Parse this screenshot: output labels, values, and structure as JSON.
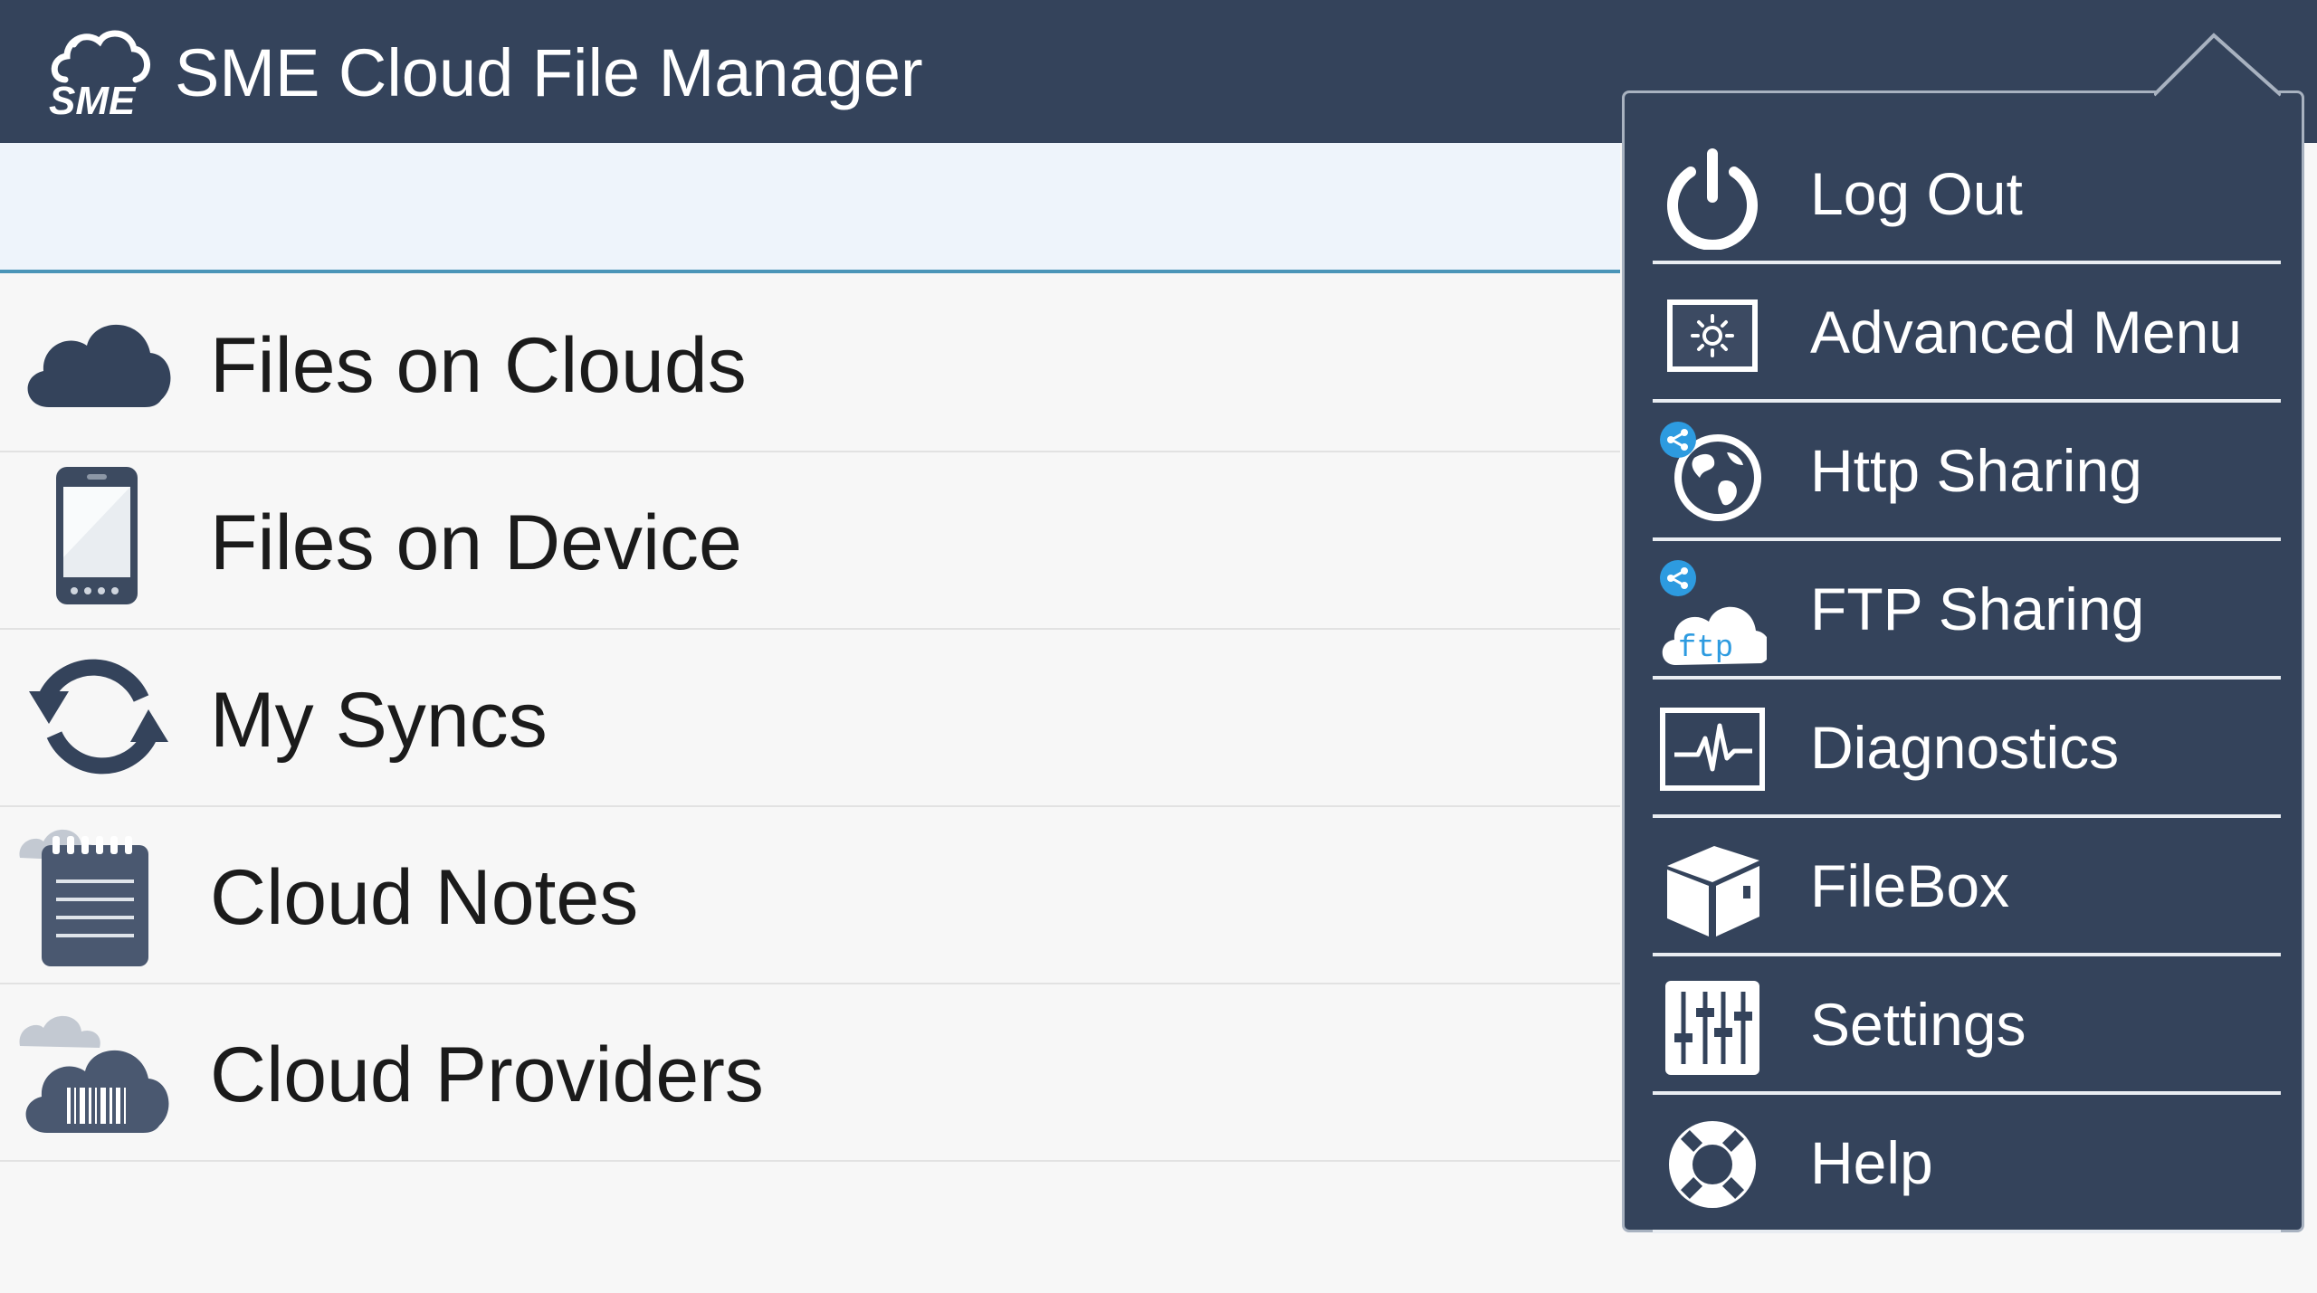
{
  "app": {
    "title": "SME Cloud File Manager",
    "logo_text": "SME"
  },
  "main": {
    "items": [
      {
        "label": "Files on Clouds",
        "icon": "cloud-icon"
      },
      {
        "label": "Files on Device",
        "icon": "phone-icon"
      },
      {
        "label": "My Syncs",
        "icon": "sync-icon"
      },
      {
        "label": "Cloud Notes",
        "icon": "notepad-icon"
      },
      {
        "label": "Cloud Providers",
        "icon": "cloud-barcode-icon"
      }
    ]
  },
  "menu": {
    "items": [
      {
        "label": "Log Out",
        "icon": "power-icon"
      },
      {
        "label": "Advanced Menu",
        "icon": "advanced-settings-icon"
      },
      {
        "label": "Http Sharing",
        "icon": "globe-share-icon"
      },
      {
        "label": "FTP Sharing",
        "icon": "ftp-cloud-share-icon",
        "badge": "ftp"
      },
      {
        "label": "Diagnostics",
        "icon": "pulse-icon"
      },
      {
        "label": "FileBox",
        "icon": "box-icon"
      },
      {
        "label": "Settings",
        "icon": "sliders-icon"
      },
      {
        "label": "Help",
        "icon": "lifebuoy-icon"
      }
    ]
  },
  "colors": {
    "appbar": "#34435b",
    "menu": "#34435b",
    "icon": "#34435b",
    "share_badge": "#2d9be0",
    "background": "#f7f7f7"
  }
}
